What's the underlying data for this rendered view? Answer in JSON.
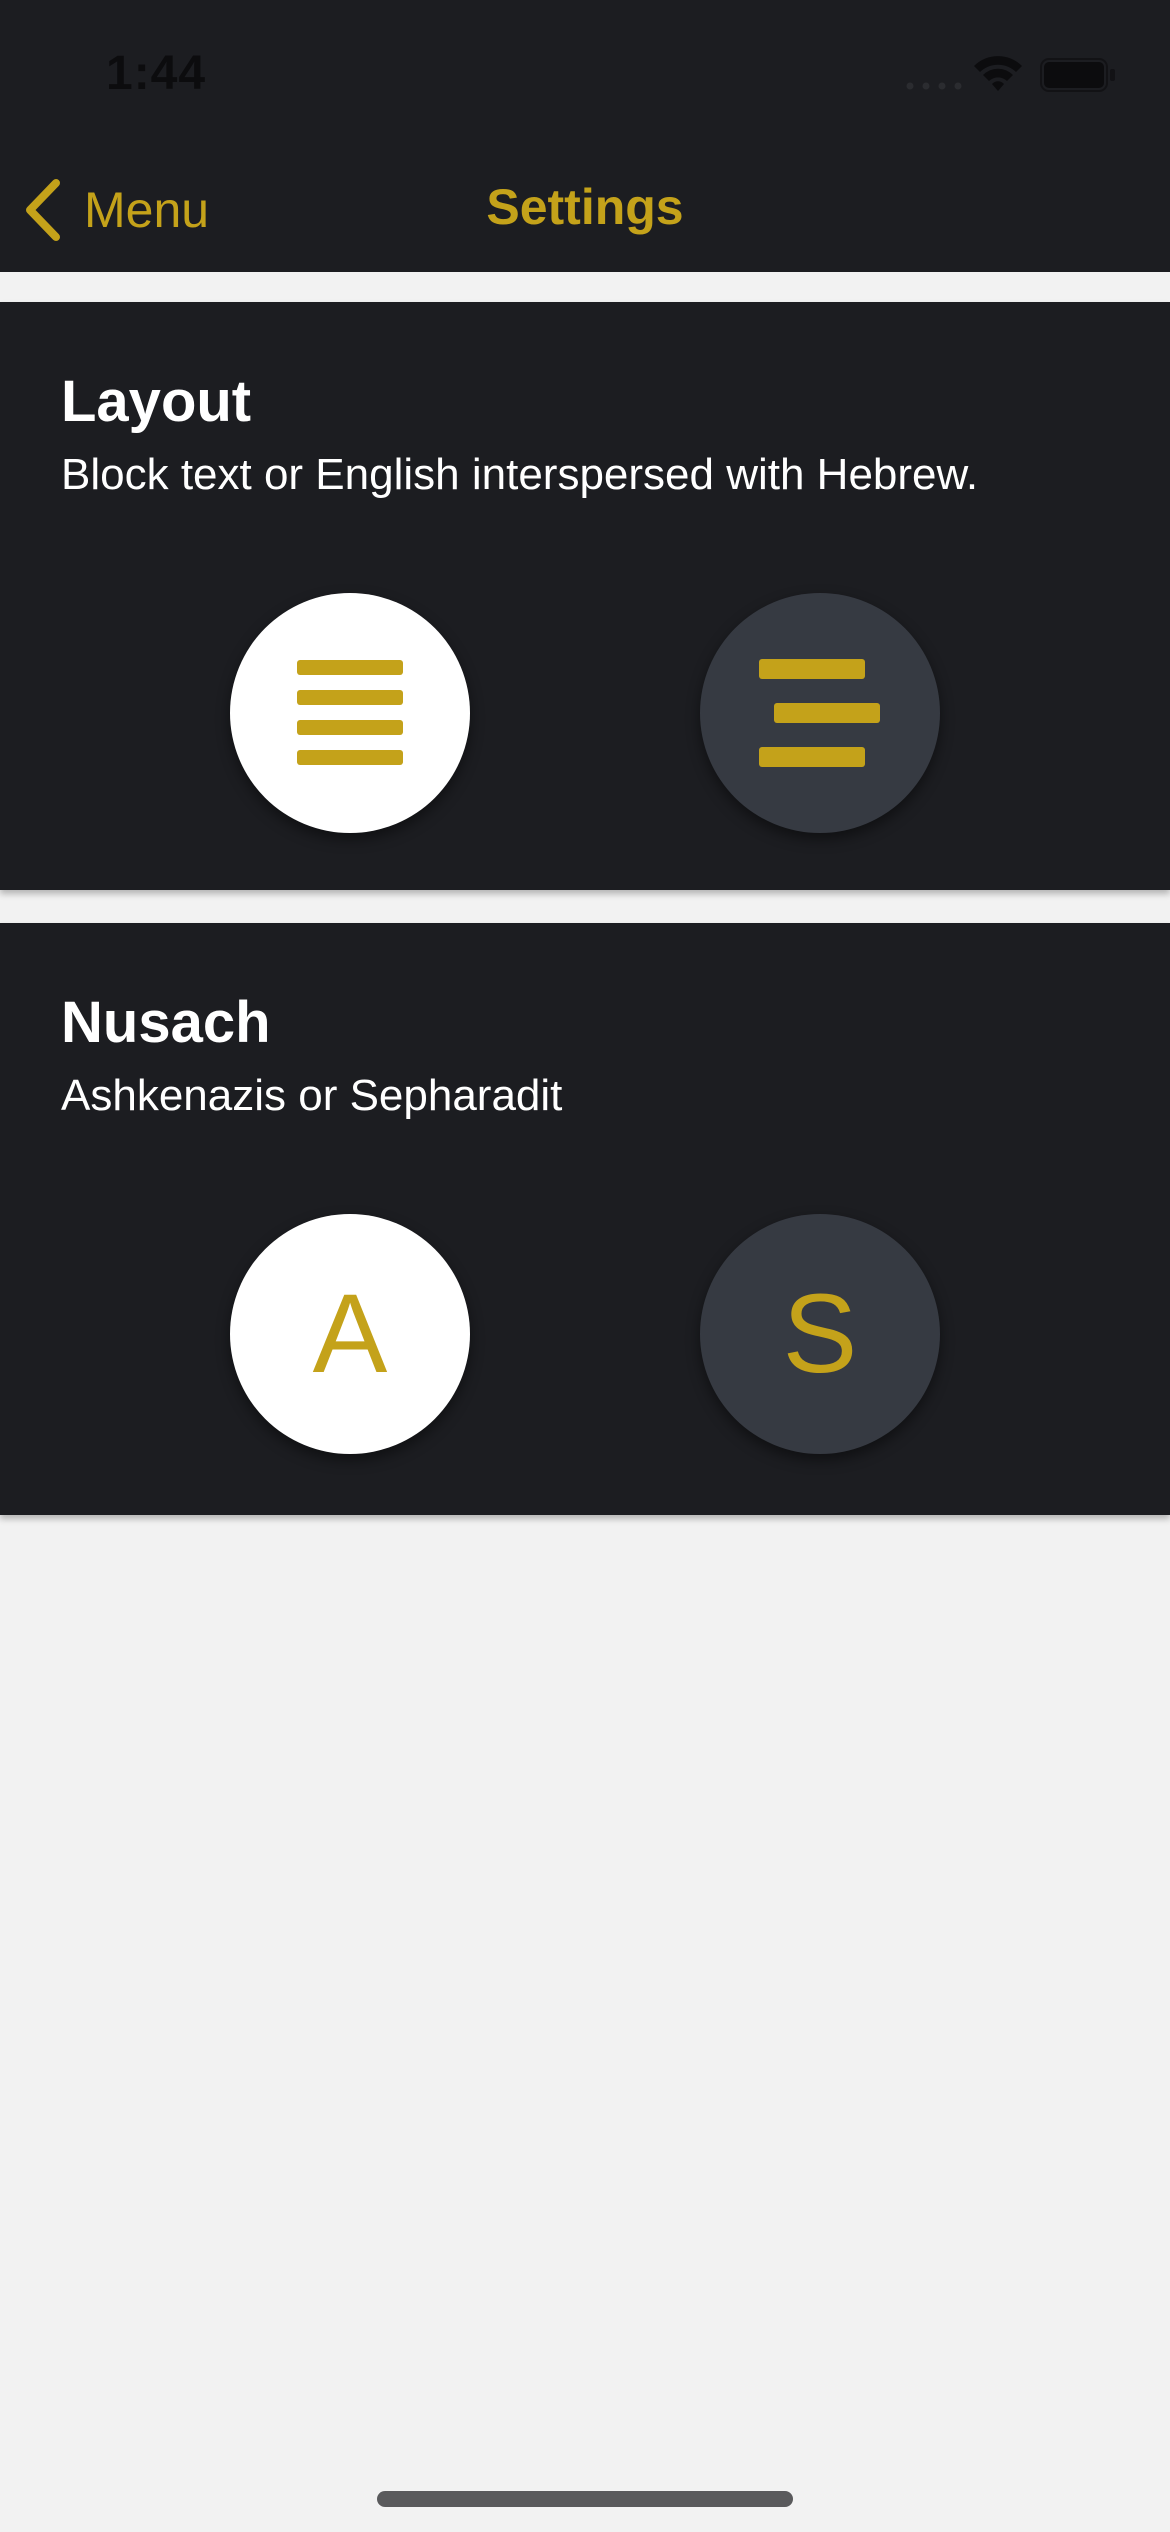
{
  "colors": {
    "accent": "#c4a21a",
    "card_background": "#1c1d21",
    "page_background": "#f2f2f2",
    "option_selected": "#ffffff",
    "option_unselected": "#363a42"
  },
  "status_bar": {
    "time": "1:44",
    "icons": [
      "cellular-signal-icon",
      "wifi-icon",
      "battery-icon"
    ]
  },
  "nav": {
    "back_label": "Menu",
    "back_icon": "chevron-left-icon",
    "title": "Settings"
  },
  "sections": {
    "layout": {
      "title": "Layout",
      "subtitle": "Block text or English interspersed with Hebrew.",
      "options": [
        {
          "icon": "block-text-icon",
          "selected": true
        },
        {
          "icon": "interspersed-text-icon",
          "selected": false
        }
      ]
    },
    "nusach": {
      "title": "Nusach",
      "subtitle": "Ashkenazis or Sepharadit",
      "options": [
        {
          "label": "A",
          "selected": true
        },
        {
          "label": "S",
          "selected": false
        }
      ]
    }
  }
}
